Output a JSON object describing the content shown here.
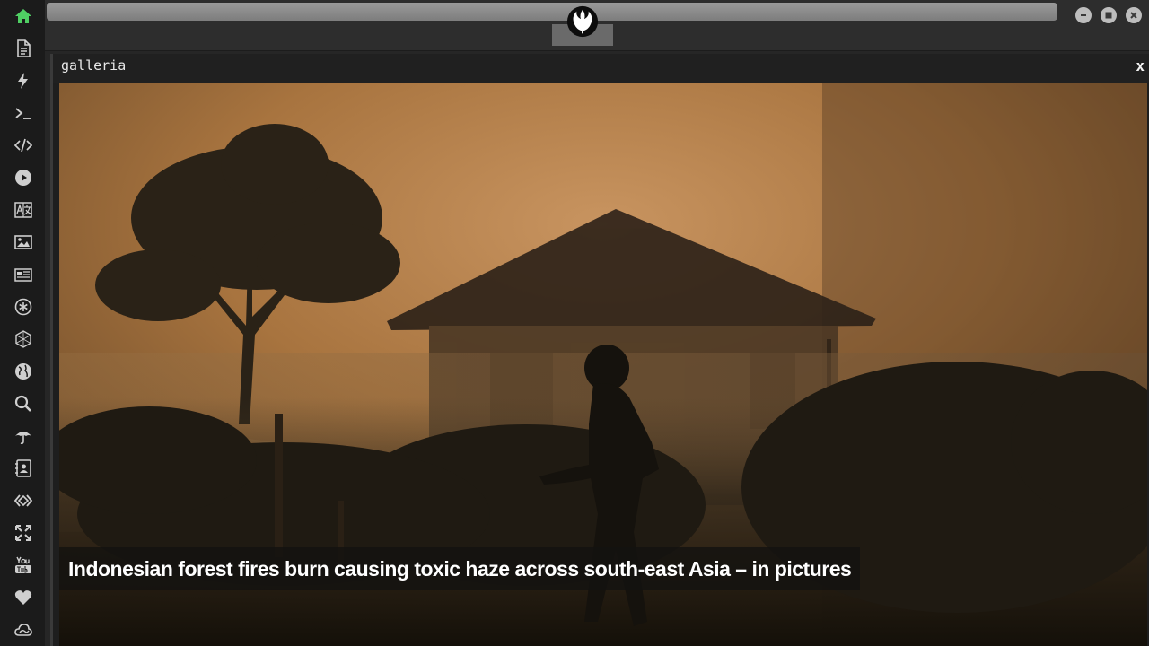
{
  "sidebar": {
    "items": [
      {
        "icon": "home-icon",
        "active": true
      },
      {
        "icon": "document-icon"
      },
      {
        "icon": "lightning-icon"
      },
      {
        "icon": "terminal-icon"
      },
      {
        "icon": "code-icon"
      },
      {
        "icon": "play-icon"
      },
      {
        "icon": "translate-icon"
      },
      {
        "icon": "image-icon"
      },
      {
        "icon": "news-icon"
      },
      {
        "icon": "settings-wheel-icon"
      },
      {
        "icon": "hexagon-icon"
      },
      {
        "icon": "globe-icon"
      },
      {
        "icon": "search-icon"
      },
      {
        "icon": "umbrella-icon"
      },
      {
        "icon": "contact-card-icon"
      },
      {
        "icon": "network-icon"
      },
      {
        "icon": "expand-icon"
      },
      {
        "icon": "youtube-icon"
      },
      {
        "icon": "heart-icon"
      },
      {
        "icon": "cloud-icon"
      }
    ],
    "active_color": "#4fcf63",
    "icon_color": "#cfcfcf"
  },
  "window_controls": {
    "minimize": "minimize-icon",
    "maximize": "maximize-icon",
    "close": "close-icon"
  },
  "logo": "rebel-alliance-logo",
  "panel": {
    "title": "galleria",
    "close_label": "x"
  },
  "gallery": {
    "caption": "Indonesian forest fires burn causing toxic haze across south-east Asia – in pictures"
  }
}
